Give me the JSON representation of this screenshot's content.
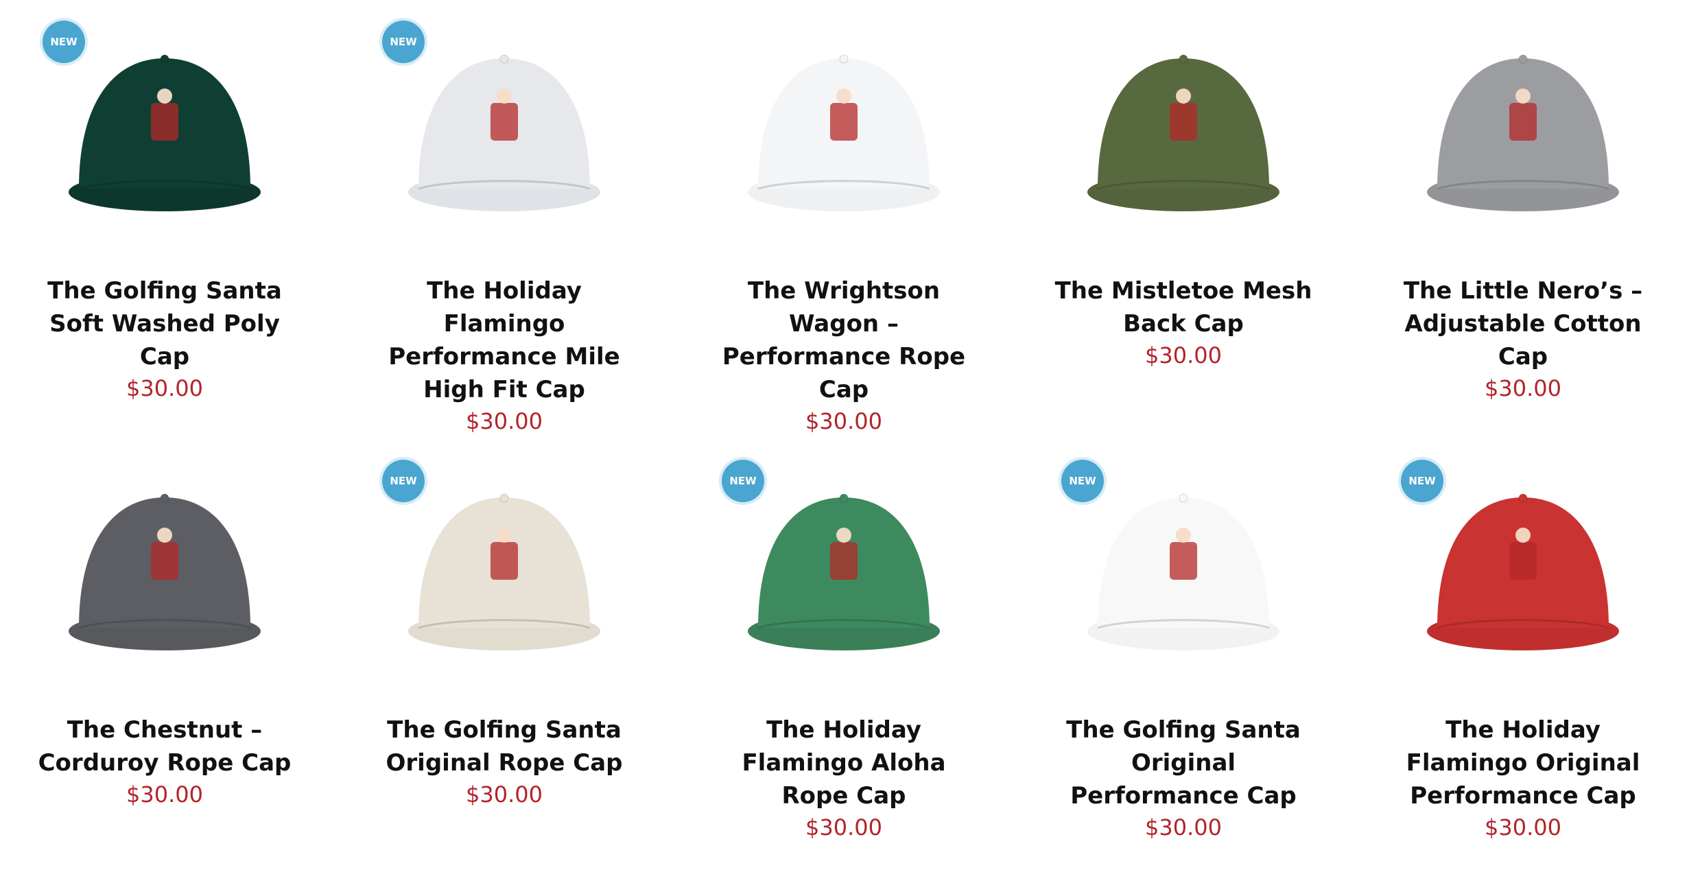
{
  "products": [
    {
      "title": "The Golfing Santa Soft Washed Poly Cap",
      "price": "$30.00",
      "badge": "NEW",
      "cap_color": "#0f3f33",
      "visor_color": "#0d372d",
      "icon": "golfing-santa-logo-icon"
    },
    {
      "title": "The Holiday Flamingo Performance Mile High Fit Cap",
      "price": "$30.00",
      "badge": "NEW",
      "cap_color": "#e6e8ec",
      "visor_color": "#dfe2e7",
      "icon": "holiday-flamingo-logo-icon"
    },
    {
      "title": "The Wrightson Wagon – Performance Rope Cap",
      "price": "$30.00",
      "badge": "",
      "cap_color": "#f4f5f6",
      "visor_color": "#eef0f2",
      "icon": "wagon-logo-icon"
    },
    {
      "title": "The Mistletoe Mesh Back Cap",
      "price": "$30.00",
      "badge": "",
      "cap_color": "#59693f",
      "visor_color": "#54633b",
      "icon": "wagon-logo-icon"
    },
    {
      "title": "The Little Nero’s – Adjustable Cotton Cap",
      "price": "$30.00",
      "badge": "",
      "cap_color": "#9c9da1",
      "visor_color": "#939498",
      "icon": "little-neros-pizza-logo-icon"
    },
    {
      "title": "The Chestnut – Corduroy Rope Cap",
      "price": "$30.00",
      "badge": "",
      "cap_color": "#5c5e63",
      "visor_color": "#57595d",
      "icon": "wagon-logo-icon"
    },
    {
      "title": "The Golfing Santa Original Rope Cap",
      "price": "$30.00",
      "badge": "NEW",
      "cap_color": "#e7e1d6",
      "visor_color": "#e2dccf",
      "icon": "golfing-santa-logo-icon"
    },
    {
      "title": "The Holiday Flamingo Aloha Rope Cap",
      "price": "$30.00",
      "badge": "NEW",
      "cap_color": "#3e8a5f",
      "visor_color": "#3a7f57",
      "icon": "holiday-flamingo-logo-icon"
    },
    {
      "title": "The Golfing Santa Original Performance Cap",
      "price": "$30.00",
      "badge": "NEW",
      "cap_color": "#f8f8f8",
      "visor_color": "#f2f2f2",
      "icon": "golfing-santa-logo-icon"
    },
    {
      "title": "The Holiday Flamingo Original Performance Cap",
      "price": "$30.00",
      "badge": "NEW",
      "cap_color": "#c93331",
      "visor_color": "#c02f2d",
      "icon": "holiday-flamingo-logo-icon"
    }
  ]
}
